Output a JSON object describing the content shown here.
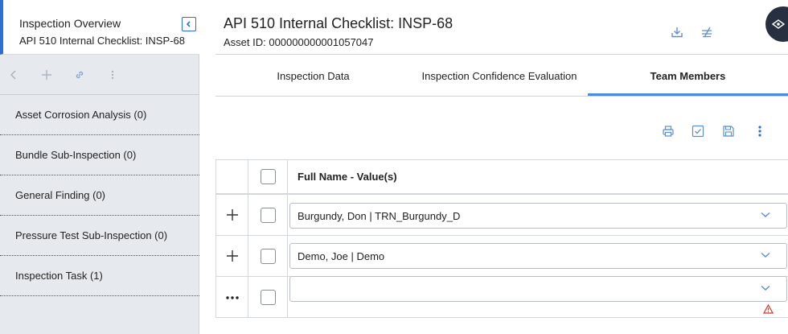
{
  "left_panel": {
    "title": "Inspection Overview",
    "subtitle": "API 510 Internal Checklist: INSP-68",
    "items": [
      {
        "label": "Asset Corrosion Analysis (0)"
      },
      {
        "label": "Bundle Sub-Inspection (0)"
      },
      {
        "label": "General Finding (0)"
      },
      {
        "label": "Pressure Test Sub-Inspection (0)"
      },
      {
        "label": "Inspection Task (1)"
      }
    ]
  },
  "header": {
    "title": "API 510 Internal Checklist: INSP-68",
    "asset_id": "Asset ID: 000000000001057047"
  },
  "tabs": [
    {
      "label": "Inspection Data"
    },
    {
      "label": "Inspection Confidence Evaluation"
    },
    {
      "label": "Team Members",
      "active": true
    }
  ],
  "grid": {
    "column_header": "Full Name - Value(s)",
    "rows": [
      {
        "value": "Burgundy, Don | TRN_Burgundy_D"
      },
      {
        "value": "Demo, Joe | Demo"
      },
      {
        "value": ""
      }
    ]
  },
  "colors": {
    "accent": "#2d6fd6",
    "icon_blue": "#5b8fd4",
    "sidebar_bg": "#e6e9ee",
    "tab_active_bar": "#4a8be0",
    "warning": "#d93025",
    "float_button": "#263040"
  }
}
